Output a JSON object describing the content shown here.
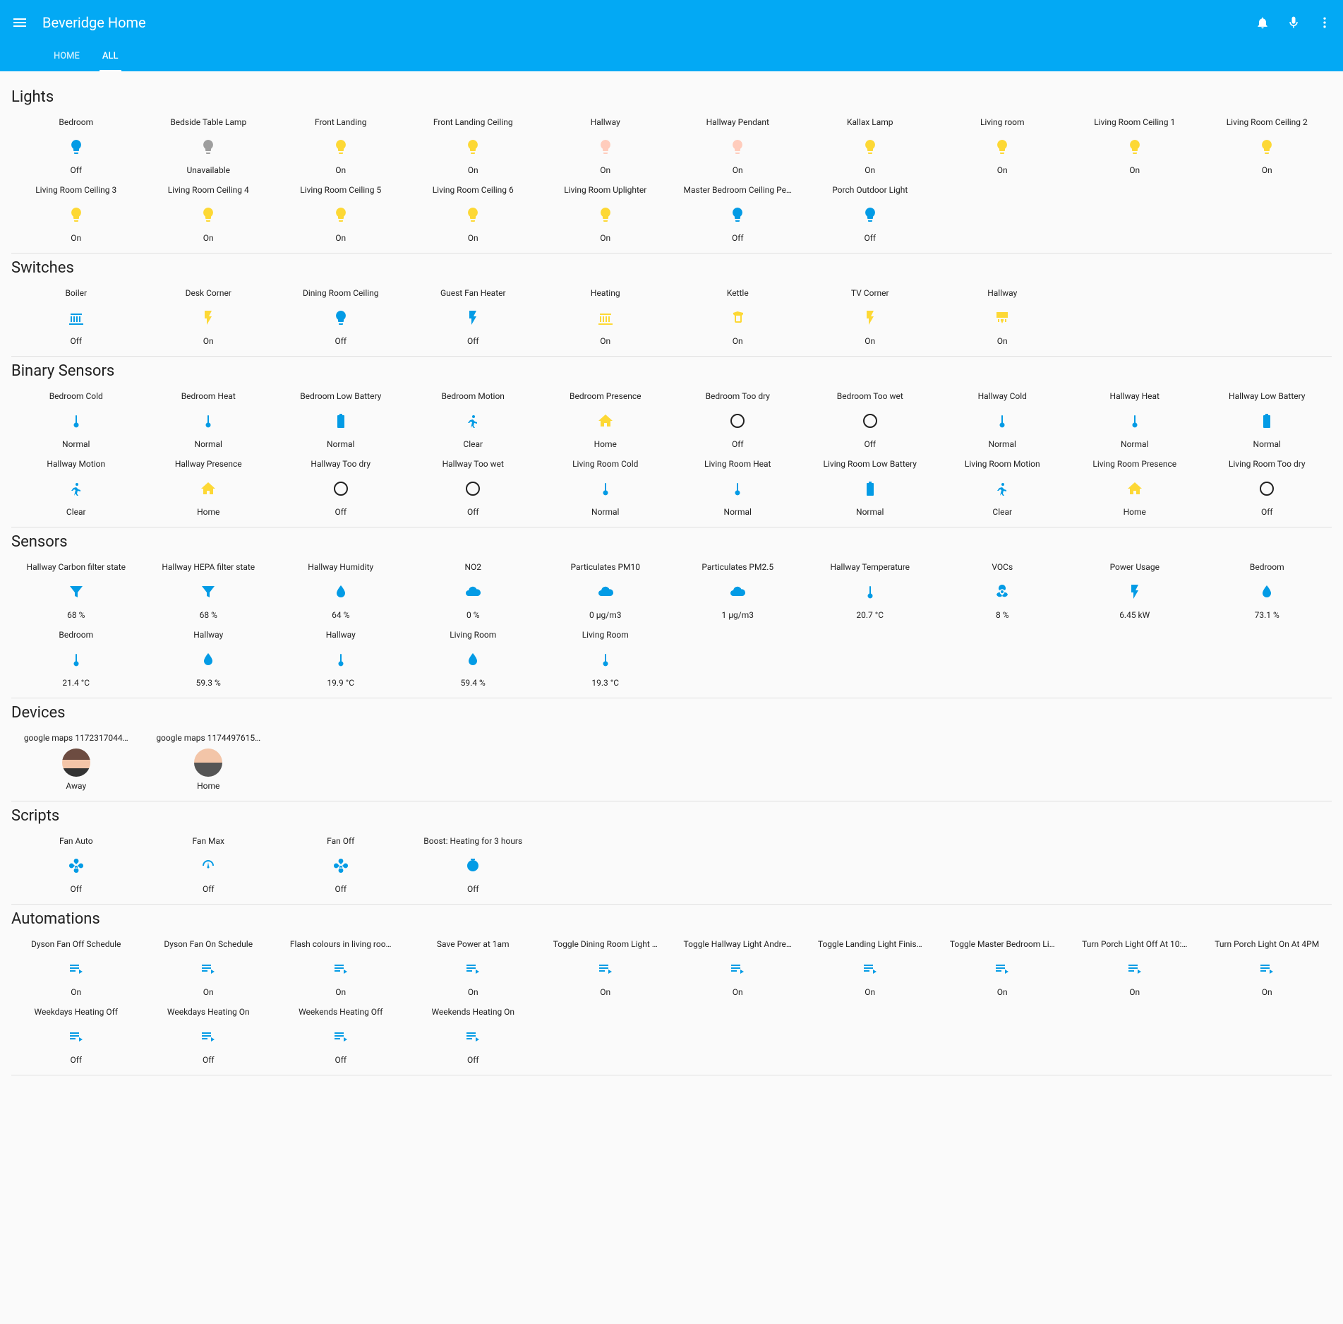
{
  "header": {
    "title": "Beveridge Home",
    "tabs": [
      {
        "label": "HOME",
        "active": false
      },
      {
        "label": "ALL",
        "active": true
      }
    ]
  },
  "sections": [
    {
      "title": "Lights",
      "items": [
        {
          "name": "Bedroom",
          "icon": "lightbulb",
          "color": "blue",
          "state": "Off"
        },
        {
          "name": "Bedside Table Lamp",
          "icon": "lightbulb",
          "color": "grey",
          "state": "Unavailable"
        },
        {
          "name": "Front Landing",
          "icon": "lightbulb",
          "color": "amber",
          "state": "On"
        },
        {
          "name": "Front Landing Ceiling",
          "icon": "lightbulb",
          "color": "amber",
          "state": "On"
        },
        {
          "name": "Hallway",
          "icon": "lightbulb",
          "color": "peach",
          "state": "On"
        },
        {
          "name": "Hallway Pendant",
          "icon": "lightbulb",
          "color": "peach",
          "state": "On"
        },
        {
          "name": "Kallax Lamp",
          "icon": "lightbulb",
          "color": "amber",
          "state": "On"
        },
        {
          "name": "Living room",
          "icon": "lightbulb",
          "color": "amber",
          "state": "On"
        },
        {
          "name": "Living Room Ceiling 1",
          "icon": "lightbulb",
          "color": "amber",
          "state": "On"
        },
        {
          "name": "Living Room Ceiling 2",
          "icon": "lightbulb",
          "color": "amber",
          "state": "On"
        },
        {
          "name": "Living Room Ceiling 3",
          "icon": "lightbulb",
          "color": "amber",
          "state": "On"
        },
        {
          "name": "Living Room Ceiling 4",
          "icon": "lightbulb",
          "color": "amber",
          "state": "On"
        },
        {
          "name": "Living Room Ceiling 5",
          "icon": "lightbulb",
          "color": "amber",
          "state": "On"
        },
        {
          "name": "Living Room Ceiling 6",
          "icon": "lightbulb",
          "color": "amber",
          "state": "On"
        },
        {
          "name": "Living Room Uplighter",
          "icon": "lightbulb",
          "color": "amber",
          "state": "On"
        },
        {
          "name": "Master Bedroom Ceiling Pe…",
          "icon": "lightbulb",
          "color": "blue",
          "state": "Off"
        },
        {
          "name": "Porch Outdoor Light",
          "icon": "lightbulb",
          "color": "blue",
          "state": "Off"
        }
      ]
    },
    {
      "title": "Switches",
      "items": [
        {
          "name": "Boiler",
          "icon": "radiator",
          "color": "blue",
          "state": "Off"
        },
        {
          "name": "Desk Corner",
          "icon": "flash",
          "color": "amber",
          "state": "On"
        },
        {
          "name": "Dining Room Ceiling",
          "icon": "lightbulb",
          "color": "blue",
          "state": "Off"
        },
        {
          "name": "Guest Fan Heater",
          "icon": "flash",
          "color": "blue",
          "state": "Off"
        },
        {
          "name": "Heating",
          "icon": "radiator",
          "color": "amber",
          "state": "On"
        },
        {
          "name": "Kettle",
          "icon": "kettle",
          "color": "amber",
          "state": "On"
        },
        {
          "name": "TV Corner",
          "icon": "flash",
          "color": "amber",
          "state": "On"
        },
        {
          "name": "Hallway",
          "icon": "aircon",
          "color": "amber",
          "state": "On"
        }
      ]
    },
    {
      "title": "Binary Sensors",
      "items": [
        {
          "name": "Bedroom Cold",
          "icon": "thermometer",
          "color": "blue",
          "state": "Normal"
        },
        {
          "name": "Bedroom Heat",
          "icon": "thermometer",
          "color": "blue",
          "state": "Normal"
        },
        {
          "name": "Bedroom Low Battery",
          "icon": "battery",
          "color": "blue",
          "state": "Normal"
        },
        {
          "name": "Bedroom Motion",
          "icon": "walk",
          "color": "blue",
          "state": "Clear"
        },
        {
          "name": "Bedroom Presence",
          "icon": "home",
          "color": "amber",
          "state": "Home"
        },
        {
          "name": "Bedroom Too dry",
          "icon": "circle",
          "color": "blue",
          "state": "Off"
        },
        {
          "name": "Bedroom Too wet",
          "icon": "circle",
          "color": "blue",
          "state": "Off"
        },
        {
          "name": "Hallway Cold",
          "icon": "thermometer",
          "color": "blue",
          "state": "Normal"
        },
        {
          "name": "Hallway Heat",
          "icon": "thermometer",
          "color": "blue",
          "state": "Normal"
        },
        {
          "name": "Hallway Low Battery",
          "icon": "battery",
          "color": "blue",
          "state": "Normal"
        },
        {
          "name": "Hallway Motion",
          "icon": "walk",
          "color": "blue",
          "state": "Clear"
        },
        {
          "name": "Hallway Presence",
          "icon": "home",
          "color": "amber",
          "state": "Home"
        },
        {
          "name": "Hallway Too dry",
          "icon": "circle",
          "color": "blue",
          "state": "Off"
        },
        {
          "name": "Hallway Too wet",
          "icon": "circle",
          "color": "blue",
          "state": "Off"
        },
        {
          "name": "Living Room Cold",
          "icon": "thermometer",
          "color": "blue",
          "state": "Normal"
        },
        {
          "name": "Living Room Heat",
          "icon": "thermometer",
          "color": "blue",
          "state": "Normal"
        },
        {
          "name": "Living Room Low Battery",
          "icon": "battery",
          "color": "blue",
          "state": "Normal"
        },
        {
          "name": "Living Room Motion",
          "icon": "walk",
          "color": "blue",
          "state": "Clear"
        },
        {
          "name": "Living Room Presence",
          "icon": "home",
          "color": "amber",
          "state": "Home"
        },
        {
          "name": "Living Room Too dry",
          "icon": "circle",
          "color": "blue",
          "state": "Off"
        }
      ]
    },
    {
      "title": "Sensors",
      "items": [
        {
          "name": "Hallway Carbon filter state",
          "icon": "filter",
          "color": "blue",
          "state": "68 %"
        },
        {
          "name": "Hallway HEPA filter state",
          "icon": "filter",
          "color": "blue",
          "state": "68 %"
        },
        {
          "name": "Hallway Humidity",
          "icon": "water",
          "color": "blue",
          "state": "64 %"
        },
        {
          "name": "NO2",
          "icon": "cloud",
          "color": "blue",
          "state": "0 %"
        },
        {
          "name": "Particulates PM10",
          "icon": "cloud",
          "color": "blue",
          "state": "0 µg/m3"
        },
        {
          "name": "Particulates PM2.5",
          "icon": "cloud",
          "color": "blue",
          "state": "1 µg/m3"
        },
        {
          "name": "Hallway Temperature",
          "icon": "thermometer",
          "color": "blue",
          "state": "20.7 °C"
        },
        {
          "name": "VOCs",
          "icon": "biohazard",
          "color": "blue",
          "state": "8 %"
        },
        {
          "name": "Power Usage",
          "icon": "flash",
          "color": "blue",
          "state": "6.45 kW"
        },
        {
          "name": "Bedroom",
          "icon": "water",
          "color": "blue",
          "state": "73.1 %"
        },
        {
          "name": "Bedroom",
          "icon": "thermometer",
          "color": "blue",
          "state": "21.4 °C"
        },
        {
          "name": "Hallway",
          "icon": "water",
          "color": "blue",
          "state": "59.3 %"
        },
        {
          "name": "Hallway",
          "icon": "thermometer",
          "color": "blue",
          "state": "19.9 °C"
        },
        {
          "name": "Living Room",
          "icon": "water",
          "color": "blue",
          "state": "59.4 %"
        },
        {
          "name": "Living Room",
          "icon": "thermometer",
          "color": "blue",
          "state": "19.3 °C"
        }
      ]
    },
    {
      "title": "Devices",
      "items": [
        {
          "name": "google maps 1172317044…",
          "icon": "avatar-f",
          "color": "",
          "state": "Away"
        },
        {
          "name": "google maps 1174497615…",
          "icon": "avatar-m",
          "color": "",
          "state": "Home"
        }
      ]
    },
    {
      "title": "Scripts",
      "items": [
        {
          "name": "Fan Auto",
          "icon": "fan",
          "color": "blue",
          "state": "Off"
        },
        {
          "name": "Fan Max",
          "icon": "gauge",
          "color": "blue",
          "state": "Off"
        },
        {
          "name": "Fan Off",
          "icon": "fan",
          "color": "blue",
          "state": "Off"
        },
        {
          "name": "Boost: Heating for 3 hours",
          "icon": "timer",
          "color": "blue",
          "state": "Off"
        }
      ]
    },
    {
      "title": "Automations",
      "items": [
        {
          "name": "Dyson Fan Off Schedule",
          "icon": "playlist",
          "color": "blue",
          "state": "On"
        },
        {
          "name": "Dyson Fan On Schedule",
          "icon": "playlist",
          "color": "blue",
          "state": "On"
        },
        {
          "name": "Flash colours in living roo…",
          "icon": "playlist",
          "color": "blue",
          "state": "On"
        },
        {
          "name": "Save Power at 1am",
          "icon": "playlist",
          "color": "blue",
          "state": "On"
        },
        {
          "name": "Toggle Dining Room Light …",
          "icon": "playlist",
          "color": "blue",
          "state": "On"
        },
        {
          "name": "Toggle Hallway Light Andre…",
          "icon": "playlist",
          "color": "blue",
          "state": "On"
        },
        {
          "name": "Toggle Landing Light Finis…",
          "icon": "playlist",
          "color": "blue",
          "state": "On"
        },
        {
          "name": "Toggle Master Bedroom Li…",
          "icon": "playlist",
          "color": "blue",
          "state": "On"
        },
        {
          "name": "Turn Porch Light Off At 10:…",
          "icon": "playlist",
          "color": "blue",
          "state": "On"
        },
        {
          "name": "Turn Porch Light On At 4PM",
          "icon": "playlist",
          "color": "blue",
          "state": "On"
        },
        {
          "name": "Weekdays Heating Off",
          "icon": "playlist",
          "color": "blue",
          "state": "Off"
        },
        {
          "name": "Weekdays Heating On",
          "icon": "playlist",
          "color": "blue",
          "state": "Off"
        },
        {
          "name": "Weekends Heating Off",
          "icon": "playlist",
          "color": "blue",
          "state": "Off"
        },
        {
          "name": "Weekends Heating On",
          "icon": "playlist",
          "color": "blue",
          "state": "Off"
        }
      ]
    }
  ]
}
